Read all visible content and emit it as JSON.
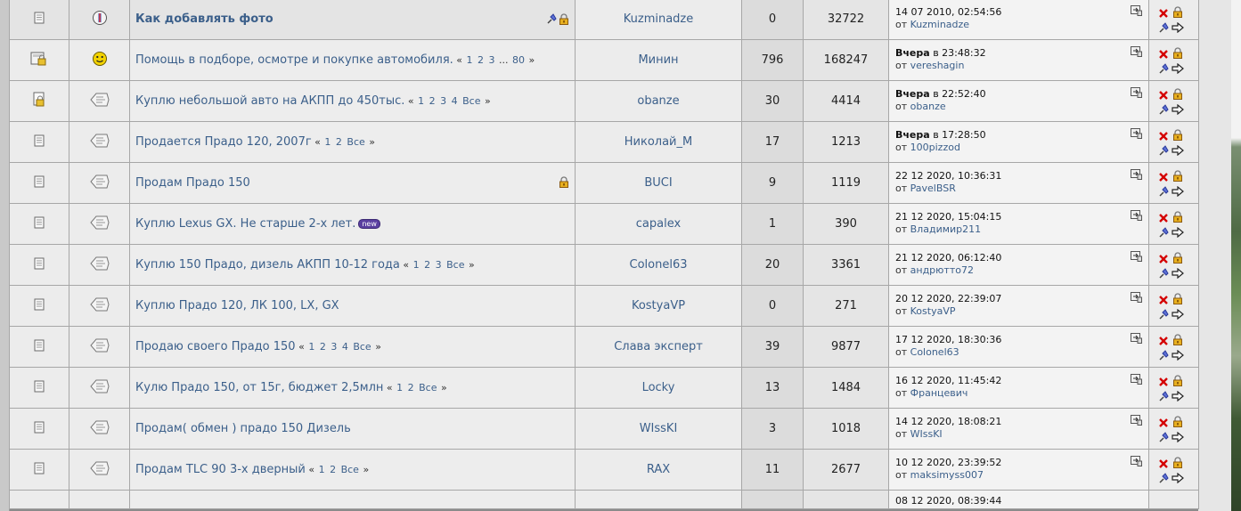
{
  "colors": {
    "link": "#3b5f8a",
    "row_bg": "#ececec",
    "replies_bg": "#dcdcdc",
    "new_badge": "#5a3fa0"
  },
  "topics": [
    {
      "status_icon": "page-icon",
      "topic_icon": "info-icon",
      "title": "Как добавлять фото",
      "bold": true,
      "pages": [],
      "all_label": "",
      "badge": "",
      "flags": [
        "pin-icon",
        "lock-icon"
      ],
      "starter": "Kuzminadze",
      "replies": "0",
      "views": "32722",
      "last_date_prefix": "",
      "last_date": "14 07 2010, 02:54:56",
      "last_from_label": "от",
      "last_by": "Kuzminadze"
    },
    {
      "status_icon": "hot-locked-page-icon",
      "topic_icon": "smiley-icon",
      "title": "Помощь в подборе, осмотре и покупке автомобиля.",
      "bold": false,
      "pages": [
        "1",
        "2",
        "3",
        "...",
        "80"
      ],
      "all_label": "",
      "badge": "",
      "flags": [],
      "starter": "Минин",
      "replies": "796",
      "views": "168247",
      "last_date_prefix": "Вчера",
      "last_date": "в 23:48:32",
      "last_from_label": "от",
      "last_by": "vereshagin"
    },
    {
      "status_icon": "locked-page-icon",
      "topic_icon": "diamond-icon",
      "title": "Куплю небольшой авто на АКПП до 450тыс.",
      "bold": false,
      "pages": [
        "1",
        "2",
        "3",
        "4"
      ],
      "all_label": "Все",
      "badge": "",
      "flags": [],
      "starter": "obanze",
      "replies": "30",
      "views": "4414",
      "last_date_prefix": "Вчера",
      "last_date": "в 22:52:40",
      "last_from_label": "от",
      "last_by": "obanze"
    },
    {
      "status_icon": "page-icon",
      "topic_icon": "diamond-icon",
      "title": "Продается Прадо 120, 2007г",
      "bold": false,
      "pages": [
        "1",
        "2"
      ],
      "all_label": "Все",
      "badge": "",
      "flags": [],
      "starter": "Николай_М",
      "replies": "17",
      "views": "1213",
      "last_date_prefix": "Вчера",
      "last_date": "в 17:28:50",
      "last_from_label": "от",
      "last_by": "100pizzod"
    },
    {
      "status_icon": "page-icon",
      "topic_icon": "diamond-icon",
      "title": "Продам Прадо 150",
      "bold": false,
      "pages": [],
      "all_label": "",
      "badge": "",
      "flags": [
        "lock-icon"
      ],
      "starter": "BUCI",
      "replies": "9",
      "views": "1119",
      "last_date_prefix": "",
      "last_date": "22 12 2020, 10:36:31",
      "last_from_label": "от",
      "last_by": "PavelBSR"
    },
    {
      "status_icon": "page-icon",
      "topic_icon": "diamond-icon",
      "title": "Куплю Lexus GX. Не старше 2-х лет.",
      "bold": false,
      "pages": [],
      "all_label": "",
      "badge": "new",
      "flags": [],
      "starter": "capalex",
      "replies": "1",
      "views": "390",
      "last_date_prefix": "",
      "last_date": "21 12 2020, 15:04:15",
      "last_from_label": "от",
      "last_by": "Владимир211"
    },
    {
      "status_icon": "page-icon",
      "topic_icon": "diamond-icon",
      "title": "Куплю 150 Прадо, дизель АКПП 10-12 года",
      "bold": false,
      "pages": [
        "1",
        "2",
        "3"
      ],
      "all_label": "Все",
      "badge": "",
      "flags": [],
      "starter": "Colonel63",
      "replies": "20",
      "views": "3361",
      "last_date_prefix": "",
      "last_date": "21 12 2020, 06:12:40",
      "last_from_label": "от",
      "last_by": "андрютто72"
    },
    {
      "status_icon": "page-icon",
      "topic_icon": "diamond-icon",
      "title": "Куплю Прадо 120, ЛК 100, LX, GX",
      "bold": false,
      "pages": [],
      "all_label": "",
      "badge": "",
      "flags": [],
      "starter": "KostyaVP",
      "replies": "0",
      "views": "271",
      "last_date_prefix": "",
      "last_date": "20 12 2020, 22:39:07",
      "last_from_label": "от",
      "last_by": "KostyaVP"
    },
    {
      "status_icon": "page-icon",
      "topic_icon": "diamond-icon",
      "title": "Продаю своего Прадо 150",
      "bold": false,
      "pages": [
        "1",
        "2",
        "3",
        "4"
      ],
      "all_label": "Все",
      "badge": "",
      "flags": [],
      "starter": "Слава эксперт",
      "replies": "39",
      "views": "9877",
      "last_date_prefix": "",
      "last_date": "17 12 2020, 18:30:36",
      "last_from_label": "от",
      "last_by": "Colonel63"
    },
    {
      "status_icon": "page-icon",
      "topic_icon": "diamond-icon",
      "title": "Кулю Прадо 150, от 15г, бюджет 2,5млн",
      "bold": false,
      "pages": [
        "1",
        "2"
      ],
      "all_label": "Все",
      "badge": "",
      "flags": [],
      "starter": "Locky",
      "replies": "13",
      "views": "1484",
      "last_date_prefix": "",
      "last_date": "16 12 2020, 11:45:42",
      "last_from_label": "от",
      "last_by": "Францевич"
    },
    {
      "status_icon": "page-icon",
      "topic_icon": "diamond-icon",
      "title": "Продам( обмен ) прадо 150 Дизель",
      "bold": false,
      "pages": [],
      "all_label": "",
      "badge": "",
      "flags": [],
      "starter": "WIssKI",
      "replies": "3",
      "views": "1018",
      "last_date_prefix": "",
      "last_date": "14 12 2020, 18:08:21",
      "last_from_label": "от",
      "last_by": "WIssKI"
    },
    {
      "status_icon": "page-icon",
      "topic_icon": "diamond-icon",
      "title": "Продам TLC 90 3-х дверный",
      "bold": false,
      "pages": [
        "1",
        "2"
      ],
      "all_label": "Все",
      "badge": "",
      "flags": [],
      "starter": "RAX",
      "replies": "11",
      "views": "2677",
      "last_date_prefix": "",
      "last_date": "10 12 2020, 23:39:52",
      "last_from_label": "от",
      "last_by": "maksimyss007"
    }
  ],
  "partial_row": {
    "last_date": "08 12 2020, 08:39:44"
  }
}
